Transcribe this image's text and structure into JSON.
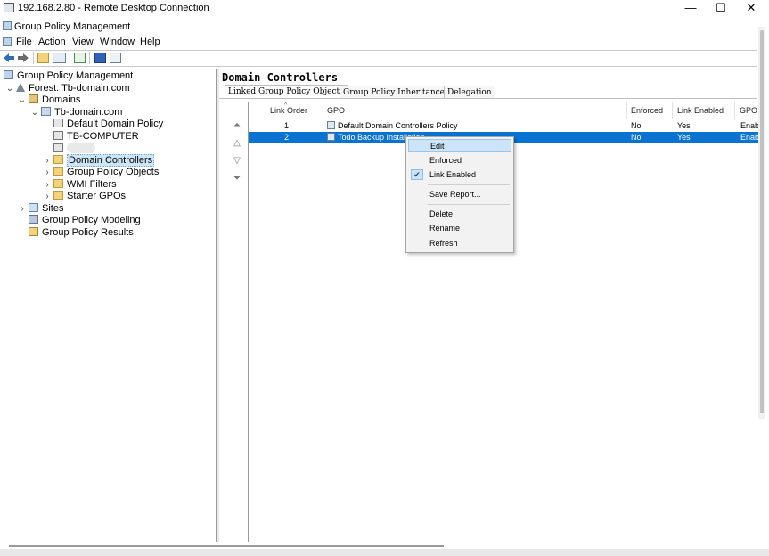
{
  "rdp": {
    "title": "192.168.2.80 - Remote Desktop Connection",
    "buttons": {
      "minimize": "—",
      "maximize": "☐",
      "close": "✕"
    }
  },
  "app": {
    "title": "Group Policy Management"
  },
  "menu": [
    "File",
    "Action",
    "View",
    "Window",
    "Help"
  ],
  "toolbar": {
    "icons": [
      "back-icon",
      "forward-icon",
      "up-folder-icon",
      "show-hide-tree-icon",
      "refresh-icon",
      "help-icon",
      "console-icon"
    ]
  },
  "tree": {
    "root": "Group Policy Management",
    "forest": "Forest: Tb-domain.com",
    "domains": "Domains",
    "domain": "Tb-domain.com",
    "default_policy": "Default Domain Policy",
    "computer": "TB-COMPUTER",
    "domain_controllers": "Domain Controllers",
    "gpos": "Group Policy Objects",
    "wmi": "WMI Filters",
    "starter": "Starter GPOs",
    "sites": "Sites",
    "modeling": "Group Policy Modeling",
    "results": "Group Policy Results"
  },
  "pane": {
    "title": "Domain Controllers",
    "tabs": [
      "Linked Group Policy Objects",
      "Group Policy Inheritance",
      "Delegation"
    ],
    "columns": [
      "Link Order",
      "GPO",
      "Enforced",
      "Link Enabled",
      "GPO"
    ],
    "rows": [
      {
        "order": "1",
        "gpo": "Default Domain Controllers Policy",
        "enforced": "No",
        "link_enabled": "Yes",
        "status": "Enab"
      },
      {
        "order": "2",
        "gpo": "Todo Backup Installation",
        "enforced": "No",
        "link_enabled": "Yes",
        "status": "Enab"
      }
    ]
  },
  "context_menu": {
    "items": [
      "Edit",
      "Enforced",
      "Link Enabled",
      "Save Report...",
      "Delete",
      "Rename",
      "Refresh"
    ],
    "checked": "Link Enabled",
    "highlighted": "Edit"
  },
  "colors": {
    "selection": "#0a72d1",
    "menu_highlight": "#cce4f7"
  }
}
